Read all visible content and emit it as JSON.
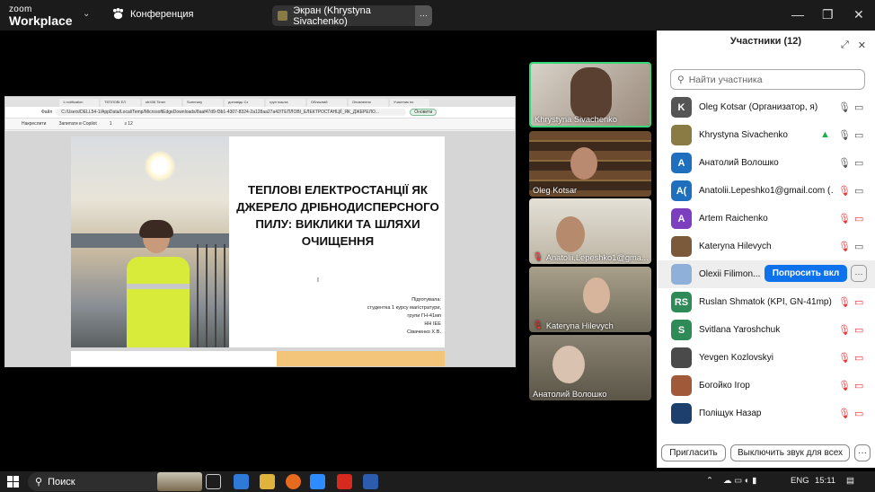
{
  "titlebar": {
    "logo_line1": "zoom",
    "logo_line2": "Workplace",
    "conference_label": "Конференция",
    "share_label": "Экран (Khrystyna Sivachenko)",
    "minimize": "—",
    "restore": "❐",
    "close": "✕"
  },
  "shared_screen": {
    "tabs": [
      "1 notification",
      "ТЕПЛОВІ ЕЛ",
      "sfr436 Timer",
      "Summary",
      "доповідь Сх",
      "груп пошта",
      "Обласний",
      "Оновлення",
      "Участник по"
    ],
    "address_label": "Файл",
    "url": "C:/Users/DELL54-1/AppData/Local/Temp/MicrosoftEdgeDownloads/8aaf47d9-f3b1-4307-8324-2a128aa27a42/ТЕПЛОВІ_ЕЛЕКТРОСТАНЦІЇ_ЯК_ДЖЕРЕЛО...",
    "update_btn": "Оновити",
    "pdf_toolbar": {
      "draw": "Накреслити",
      "ask": "Запитати в Copilot",
      "page": "1",
      "pages": "з 12"
    },
    "slide_title": "ТЕПЛОВІ ЕЛЕКТРОСТАНЦІЇ ЯК ДЖЕРЕЛО ДРІБНОДИСПЕРСНОГО ПИЛУ: ВИКЛИКИ ТА ШЛЯХИ ОЧИЩЕННЯ",
    "prepared_lines": [
      "Підготувала:",
      "студентка 1 курсу магістратури,",
      "групи ГН-41мп",
      "НН ІЕЕ",
      "Сіваченко Х.В."
    ]
  },
  "video_tiles": [
    {
      "name": "Khrystyna Sivachenko",
      "muted": false,
      "bg": "#b9a89a"
    },
    {
      "name": "Oleg Kotsar",
      "muted": false,
      "bg": "#5a3c28"
    },
    {
      "name": "Anatolii.Lepeshko1@gma...",
      "muted": true,
      "bg": "#cfc9bd"
    },
    {
      "name": "Kateryna Hilevych",
      "muted": true,
      "bg": "#8f8876"
    },
    {
      "name": "Анатолий Волошко",
      "muted": false,
      "bg": "#7a7466"
    }
  ],
  "participants_panel": {
    "title": "Участники (12)",
    "search_placeholder": "Найти участника",
    "ask_button": "Попросить вкл",
    "more_label": "···",
    "invite_button": "Пригласить",
    "mute_all_button": "Выключить звук для всех",
    "footer_more": "···",
    "participants": [
      {
        "initials": "K",
        "name": "Oleg Kotsar (Организатор, я)",
        "color": "#555555",
        "mic": "on",
        "video": "on",
        "share": false
      },
      {
        "initials": "",
        "name": "Khrystyna Sivachenko",
        "color": "#8a7a44",
        "mic": "on",
        "video": "on",
        "share": true
      },
      {
        "initials": "A",
        "name": "Анатолий Волошко",
        "color": "#1f6fbf",
        "mic": "on",
        "video": "on",
        "share": false
      },
      {
        "initials": "A(",
        "name": "Anatolii.Lepeshko1@gmail.com (…",
        "color": "#1f6fbf",
        "mic": "off",
        "video": "on",
        "share": false
      },
      {
        "initials": "A",
        "name": "Artem Raichenko",
        "color": "#7b3fbf",
        "mic": "off",
        "video": "off",
        "share": false
      },
      {
        "initials": "",
        "name": "Kateryna Hilevych",
        "color": "#7a5a3a",
        "mic": "off",
        "video": "on",
        "share": false
      },
      {
        "initials": "",
        "name": "Olexii Filimon...",
        "color": "#8fb0d8",
        "mic": "",
        "video": "",
        "share": false
      },
      {
        "initials": "RS",
        "name": "Ruslan Shmatok (KPI, GN-41mp)",
        "color": "#2e8b57",
        "mic": "off",
        "video": "off",
        "share": false
      },
      {
        "initials": "S",
        "name": "Svitlana Yaroshchuk",
        "color": "#2e8b57",
        "mic": "off",
        "video": "off",
        "share": false
      },
      {
        "initials": "",
        "name": "Yevgen Kozlovskyi",
        "color": "#4a4a4a",
        "mic": "off",
        "video": "off",
        "share": false
      },
      {
        "initials": "",
        "name": "Богойко Ігор",
        "color": "#a05a3a",
        "mic": "off",
        "video": "off",
        "share": false
      },
      {
        "initials": "",
        "name": "Поліщук Назар",
        "color": "#1c3f6e",
        "mic": "off",
        "video": "off",
        "share": false
      }
    ]
  },
  "taskbar": {
    "search_label": "Поиск",
    "lang": "ENG",
    "time": "15:11"
  }
}
